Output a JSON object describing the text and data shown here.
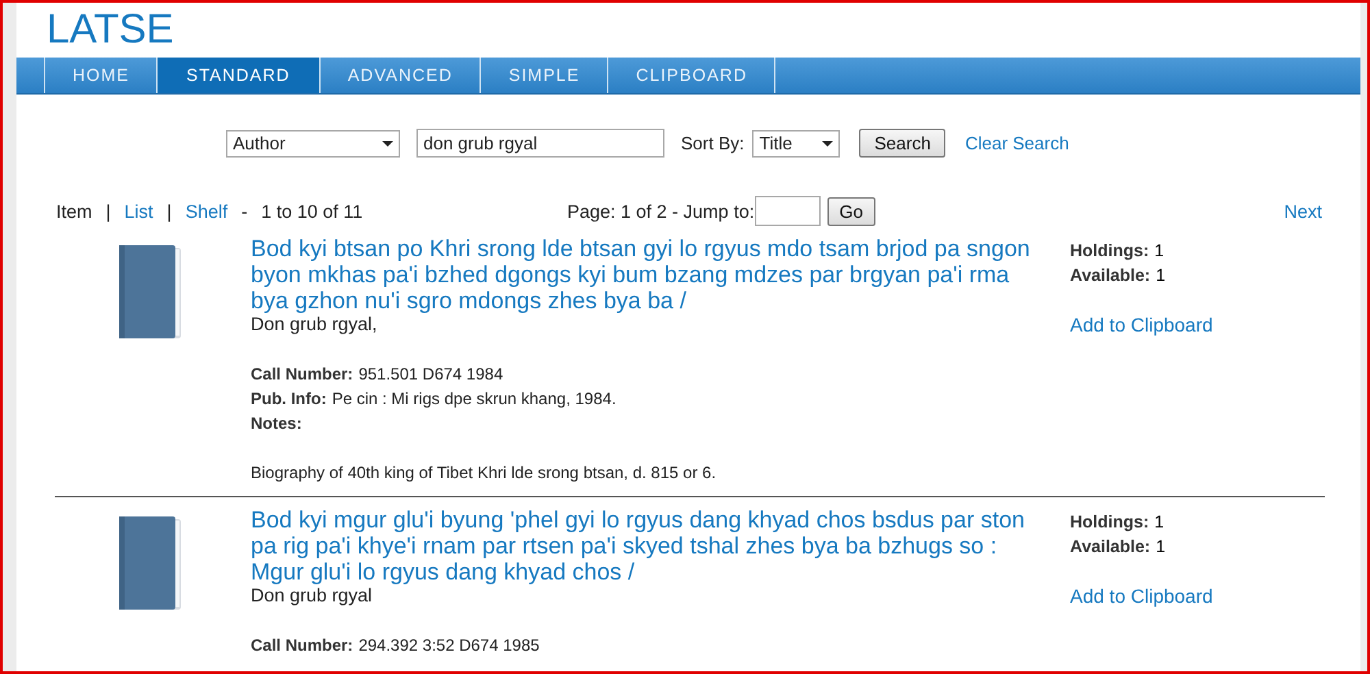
{
  "site": {
    "logo": "LATSE"
  },
  "nav": [
    {
      "label": "HOME",
      "selected": false
    },
    {
      "label": "STANDARD",
      "selected": true
    },
    {
      "label": "ADVANCED",
      "selected": false
    },
    {
      "label": "SIMPLE",
      "selected": false
    },
    {
      "label": "CLIPBOARD",
      "selected": false
    }
  ],
  "search": {
    "field": "Author",
    "query": "don grub rgyal",
    "sort_label": "Sort By:",
    "sort": "Title",
    "button": "Search",
    "clear": "Clear Search"
  },
  "results_bar": {
    "views": [
      {
        "label": "Item",
        "selected": true
      },
      {
        "label": "List",
        "selected": false
      },
      {
        "label": "Shelf",
        "selected": false
      }
    ],
    "view_separators": [
      "|",
      "|"
    ],
    "range_separator": "-",
    "range": "1 to 10 of 11",
    "page": "Page: 1 of 2 - Jump to:",
    "go": "Go",
    "next": "Next"
  },
  "records": [
    {
      "title": "Bod kyi btsan po Khri srong lde btsan gyi lo rgyus mdo tsam brjod pa sngon byon mkhas pa'i bzhed dgongs kyi bum bzang mdzes par brgyan pa'i rma bya gzhon nu'i sgro mdongs zhes bya ba /",
      "author": "Don grub rgyal,",
      "fields": [
        {
          "label": "Call Number:",
          "value": "951.501 D674 1984"
        },
        {
          "label": "Pub. Info:",
          "value": "Pe cin : Mi rigs dpe skrun khang, 1984."
        },
        {
          "label": "Notes:"
        }
      ],
      "note": "Biography of 40th king of Tibet Khri lde srong btsan, d. 815 or 6.",
      "holdings": [
        {
          "label": "Holdings:",
          "value": "1"
        },
        {
          "label": "Available:",
          "value": "1"
        }
      ],
      "clipboard": "Add to Clipboard"
    },
    {
      "title": "Bod kyi mgur glu'i byung 'phel gyi lo rgyus dang khyad chos bsdus par ston pa rig pa'i khye'i rnam par rtsen pa'i skyed tshal zhes bya ba bzhugs so : Mgur glu'i lo rgyus dang khyad chos /",
      "author": "Don grub rgyal",
      "fields": [
        {
          "label": "Call Number:",
          "value": "294.392 3:52 D674 1985"
        }
      ],
      "holdings": [
        {
          "label": "Holdings:",
          "value": "1"
        },
        {
          "label": "Available:",
          "value": "1"
        }
      ],
      "clipboard": "Add to Clipboard"
    }
  ]
}
